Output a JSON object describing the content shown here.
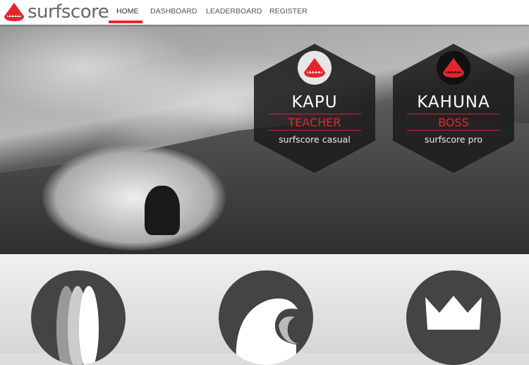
{
  "brand": {
    "name": "surfscore",
    "accent": "#e8232b"
  },
  "nav": {
    "items": [
      {
        "label": "HOME",
        "active": true
      },
      {
        "label": "DASHBOARD"
      },
      {
        "label": "LEADERBOARD"
      },
      {
        "label": "REGISTER"
      }
    ]
  },
  "plans": [
    {
      "title": "KAPU",
      "role": "TEACHER",
      "plan": "surfscore casual",
      "icon": "shark-icon-light"
    },
    {
      "title": "KAHUNA",
      "role": "BOSS",
      "plan": "surfscore pro",
      "icon": "shark-icon-dark"
    }
  ],
  "features": [
    {
      "icon": "surfboards-icon"
    },
    {
      "icon": "wave-icon"
    },
    {
      "icon": "crown-icon"
    }
  ]
}
